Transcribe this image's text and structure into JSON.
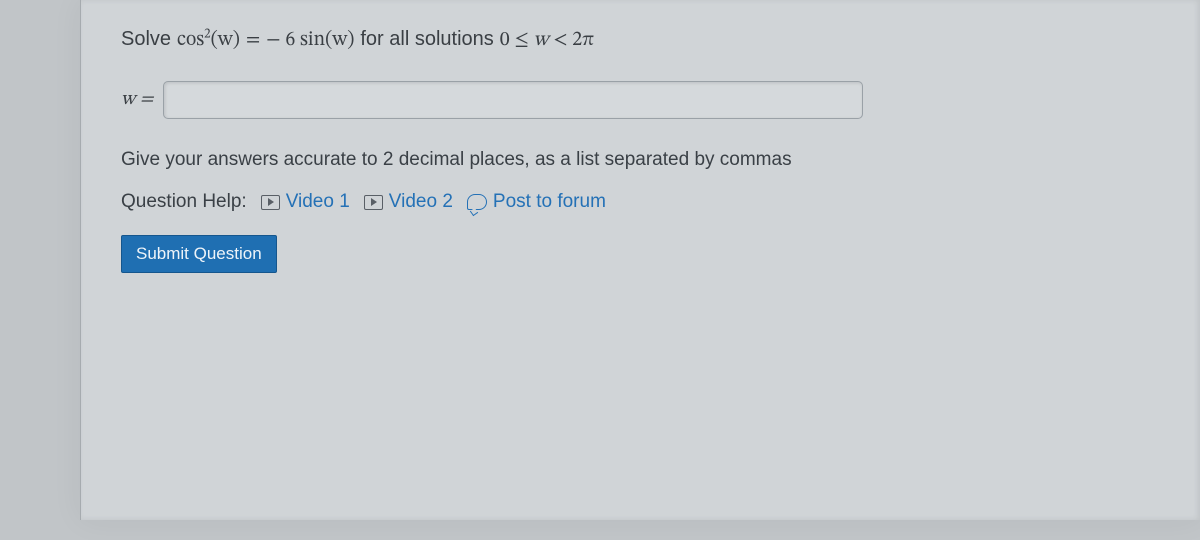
{
  "question": {
    "prefix": "Solve",
    "lhs_base": "cos",
    "lhs_exp": "2",
    "lhs_arg": "(w)",
    "equals": "=",
    "rhs_sign": "− ",
    "rhs_coef": "6",
    "rhs_fn": "sin",
    "rhs_arg": "(w)",
    "cond_prefix": "for all solutions",
    "cond_low": "0",
    "cond_rel1": "≤",
    "cond_var": "w",
    "cond_rel2": "<",
    "cond_high": "2π"
  },
  "answer": {
    "label": "w =",
    "value": ""
  },
  "hint": "Give your answers accurate to 2 decimal places, as a list separated by commas",
  "help": {
    "label": "Question Help:",
    "video1": "Video 1",
    "video2": "Video 2",
    "forum": "Post to forum"
  },
  "submit": {
    "label": "Submit Question"
  }
}
